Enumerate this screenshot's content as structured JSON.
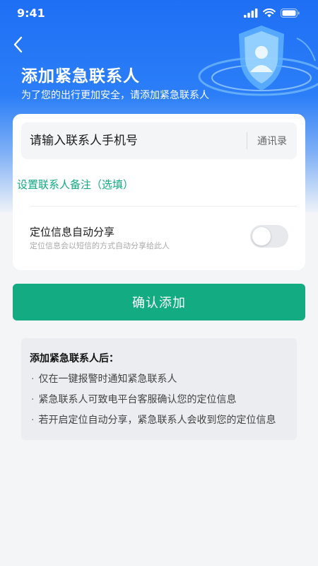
{
  "status_bar": {
    "time": "9:41"
  },
  "header": {
    "title": "添加紧急联系人",
    "subtitle": "为了您的出行更加安全，请添加紧急联系人"
  },
  "form": {
    "phone_placeholder": "请输入联系人手机号",
    "contacts_label": "通讯录",
    "remark_label": "设置联系人备注（选填）",
    "location_share_title": "定位信息自动分享",
    "location_share_desc": "定位信息会以短信的方式自动分享给此人",
    "location_share_enabled": false
  },
  "confirm_label": "确认添加",
  "info": {
    "title": "添加紧急联系人后：",
    "items": [
      "仅在一键报警时通知紧急联系人",
      "紧急联系人可致电平台客服确认您的定位信息",
      "若开启定位自动分享，紧急联系人会收到您的定位信息"
    ]
  },
  "colors": {
    "brand_blue": "#1f6ff5",
    "accent_green": "#12ab82",
    "remark_green": "#12a883"
  },
  "icons": [
    "signal-icon",
    "wifi-icon",
    "battery-icon",
    "back-chevron-icon",
    "shield-user-icon"
  ]
}
